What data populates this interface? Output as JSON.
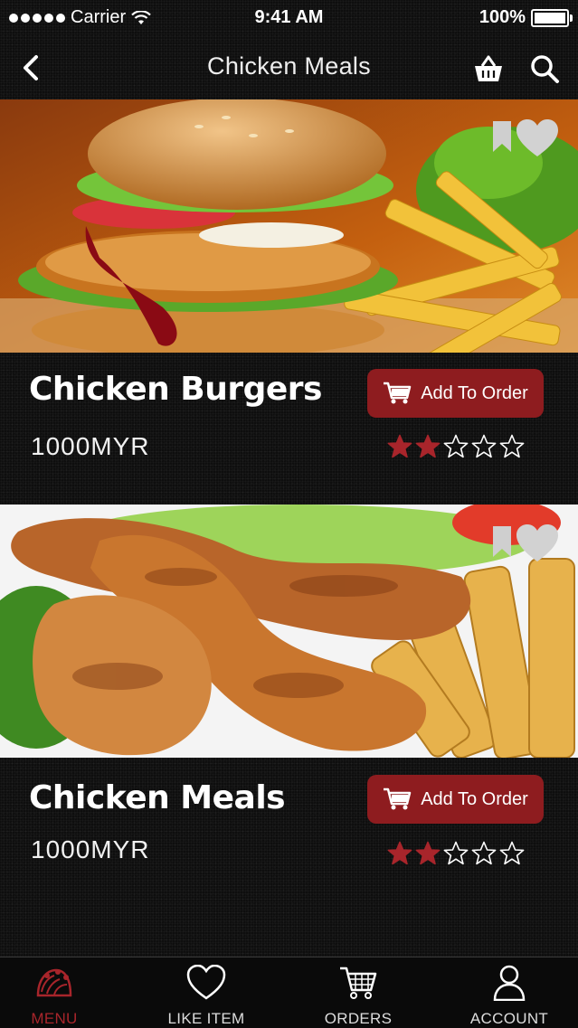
{
  "status_bar": {
    "carrier": "Carrier",
    "time": "9:41 AM",
    "battery": "100%"
  },
  "nav": {
    "title": "Chicken Meals"
  },
  "items": [
    {
      "name": "Chicken Burgers",
      "price": "1000MYR",
      "button": "Add To Order",
      "rating": 2,
      "max_rating": 5
    },
    {
      "name": "Chicken Meals",
      "price": "1000MYR",
      "button": "Add To Order",
      "rating": 2,
      "max_rating": 5
    }
  ],
  "tabs": [
    {
      "label": "MENU",
      "icon": "taco-icon",
      "active": true
    },
    {
      "label": "LIKE ITEM",
      "icon": "heart-icon",
      "active": false
    },
    {
      "label": "ORDERS",
      "icon": "cart-icon",
      "active": false
    },
    {
      "label": "ACCOUNT",
      "icon": "user-icon",
      "active": false
    }
  ],
  "colors": {
    "accent": "#a8252b",
    "button_bg": "#8e1c1f",
    "star_filled": "#a8252b",
    "background": "#0e0e0e"
  }
}
